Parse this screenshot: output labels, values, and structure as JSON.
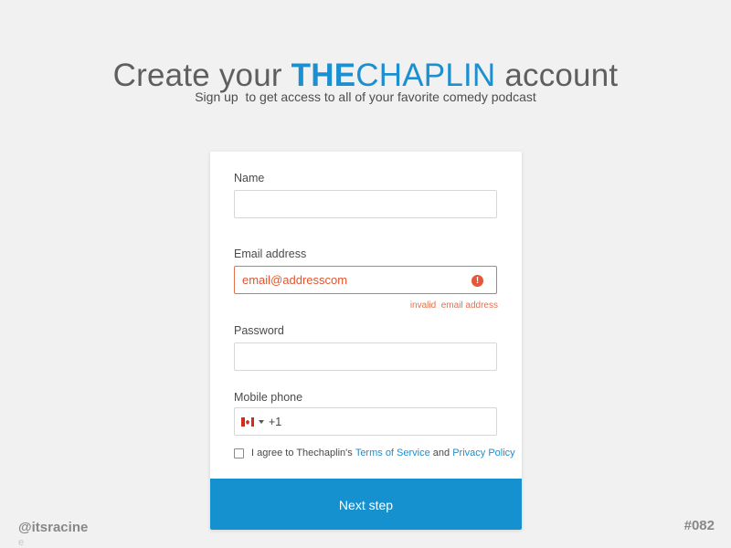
{
  "header": {
    "title_prefix": "Create your",
    "brand_bold": "THE",
    "brand_light": "CHAPLIN",
    "title_suffix": "account",
    "subtitle": "Sign up  to get access to all of your favorite comedy podcast"
  },
  "form": {
    "name": {
      "label": "Name",
      "value": ""
    },
    "email": {
      "label": "Email address",
      "value": "email@addresscom",
      "error_icon": "!",
      "error": "invalid  email address"
    },
    "password": {
      "label": "Password",
      "value": ""
    },
    "phone": {
      "label": "Mobile phone",
      "flag_icon": "canada-flag-icon",
      "dial_code": "+1"
    },
    "terms": {
      "checked": false,
      "prefix": "I agree to Thechaplin's",
      "terms_link": "Terms of Service",
      "conjunction": "and",
      "privacy_link": "Privacy Policy"
    },
    "submit_label": "Next step"
  },
  "footer": {
    "handle": "@itsracine",
    "shot_number": "#082",
    "stray": "e"
  },
  "colors": {
    "brand": "#1b8fcf",
    "button": "#1591d0",
    "error": "#e4704f",
    "background": "#f1f1f1"
  }
}
